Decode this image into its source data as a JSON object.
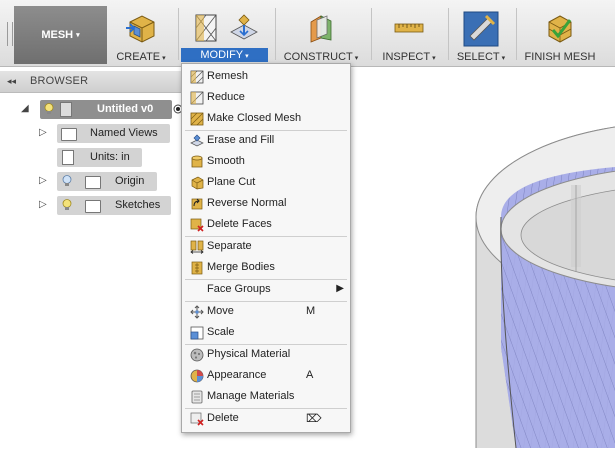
{
  "toolbar": {
    "workspace": {
      "label": "MESH"
    },
    "groups": {
      "create": {
        "label": "CREATE"
      },
      "modify": {
        "label": "MODIFY"
      },
      "construct": {
        "label": "CONSTRUCT"
      },
      "inspect": {
        "label": "INSPECT"
      },
      "select": {
        "label": "SELECT"
      },
      "finish": {
        "label": "FINISH MESH"
      }
    },
    "caret": "▾"
  },
  "browser": {
    "title": "BROWSER",
    "collapse_glyph": "◂◂",
    "root": {
      "label": "Untitled v0"
    },
    "items": [
      {
        "label": "Named Views"
      },
      {
        "label": "Units: in"
      },
      {
        "label": "Origin"
      },
      {
        "label": "Sketches"
      }
    ]
  },
  "modify_menu": {
    "items": [
      {
        "label": "Remesh",
        "icon": "remesh-icon"
      },
      {
        "label": "Reduce",
        "icon": "reduce-icon"
      },
      {
        "label": "Make Closed Mesh",
        "icon": "make-closed-mesh-icon"
      },
      {
        "label": "Erase and Fill",
        "icon": "erase-fill-icon"
      },
      {
        "label": "Smooth",
        "icon": "smooth-icon"
      },
      {
        "label": "Plane Cut",
        "icon": "plane-cut-icon"
      },
      {
        "label": "Reverse Normal",
        "icon": "reverse-normal-icon"
      },
      {
        "label": "Delete Faces",
        "icon": "delete-faces-icon"
      },
      {
        "label": "Separate",
        "icon": "separate-icon"
      },
      {
        "label": "Merge Bodies",
        "icon": "merge-bodies-icon"
      },
      {
        "label": "Face Groups",
        "icon": "",
        "submenu_arrow": "▶"
      },
      {
        "label": "Move",
        "icon": "move-icon",
        "shortcut": "M"
      },
      {
        "label": "Scale",
        "icon": "scale-icon"
      },
      {
        "label": "Physical Material",
        "icon": "physical-material-icon"
      },
      {
        "label": "Appearance",
        "icon": "appearance-icon",
        "shortcut": "A"
      },
      {
        "label": "Manage Materials",
        "icon": "manage-materials-icon"
      },
      {
        "label": "Delete",
        "icon": "delete-icon",
        "shortcut": "⌦"
      }
    ]
  },
  "colors": {
    "accent": "#2f6fc3",
    "mesh": "#a9aee8",
    "mesh_line": "#6f74b4",
    "panel": "#d3d3d3",
    "active_row": "#8f8f8f"
  }
}
